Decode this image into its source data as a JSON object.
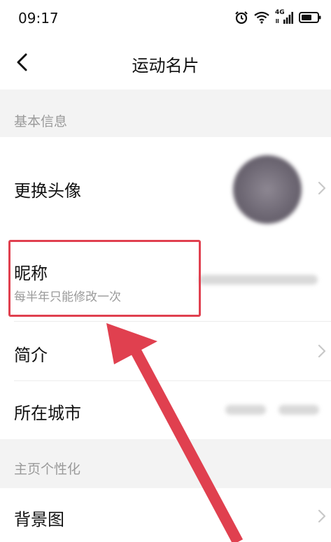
{
  "status_bar": {
    "time": "09:17",
    "network": "4G"
  },
  "nav": {
    "title": "运动名片",
    "back_icon": "chevron-left-icon"
  },
  "sections": {
    "basic_info": "基本信息",
    "homepage_personalize": "主页个性化"
  },
  "rows": {
    "avatar": {
      "label": "更换头像"
    },
    "nickname": {
      "label": "昵称",
      "hint": "每半年只能修改一次"
    },
    "intro": {
      "label": "简介"
    },
    "city": {
      "label": "所在城市"
    },
    "background": {
      "label": "背景图"
    }
  },
  "colors": {
    "highlight": "#e0404f",
    "section_bg": "#f3f3f3",
    "secondary_text": "#9a9a9a"
  }
}
